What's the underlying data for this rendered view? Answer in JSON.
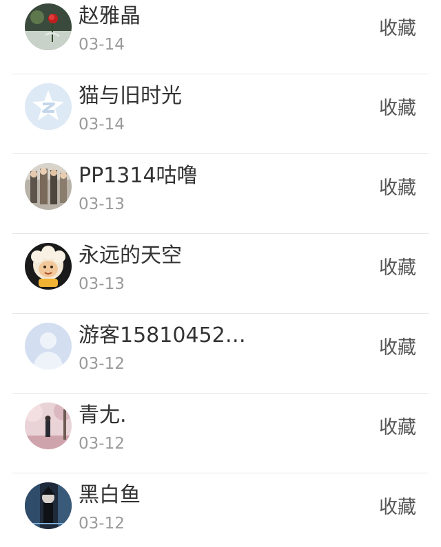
{
  "list": {
    "items": [
      {
        "name": "赵雅晶",
        "date": "03-14",
        "action": "收藏",
        "avatar": "rose-photo-avatar"
      },
      {
        "name": "猫与旧时光",
        "date": "03-14",
        "action": "收藏",
        "avatar": "default-qq-star-avatar"
      },
      {
        "name": "PP1314咕噜",
        "date": "03-13",
        "action": "收藏",
        "avatar": "group-photo-avatar"
      },
      {
        "name": "永远的天空",
        "date": "03-13",
        "action": "收藏",
        "avatar": "cartoon-sheep-avatar"
      },
      {
        "name": "游客15810452…",
        "date": "03-12",
        "action": "收藏",
        "avatar": "default-person-avatar"
      },
      {
        "name": "青尢.",
        "date": "03-12",
        "action": "收藏",
        "avatar": "cherry-blossom-photo-avatar"
      },
      {
        "name": "黑白鱼",
        "date": "03-12",
        "action": "收藏",
        "avatar": "anime-character-avatar"
      }
    ]
  }
}
